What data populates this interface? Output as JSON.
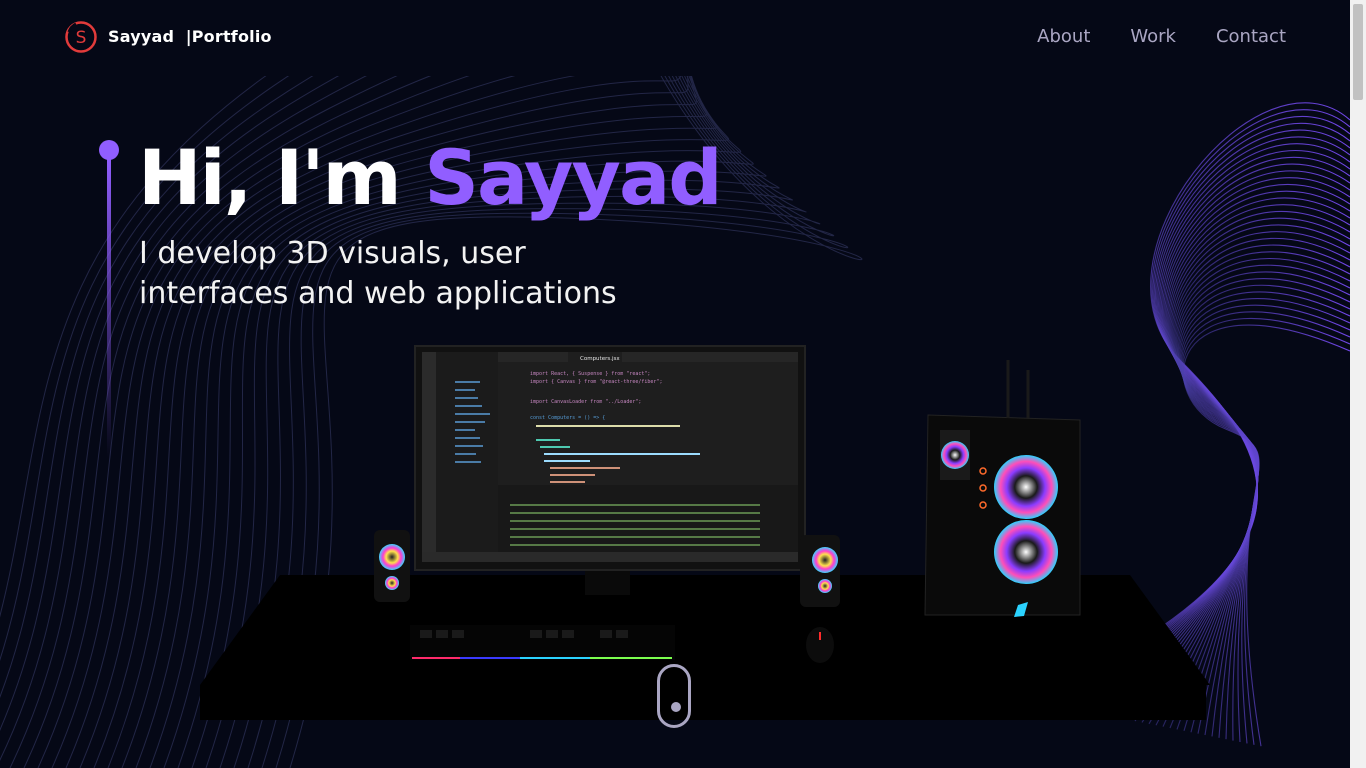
{
  "header": {
    "brand_name": "Sayyad",
    "brand_suffix": "|Portfolio",
    "logo_letter": "S",
    "nav": [
      {
        "label": "About"
      },
      {
        "label": "Work"
      },
      {
        "label": "Contact"
      }
    ]
  },
  "hero": {
    "greeting": "Hi, I'm",
    "name": "Sayyad",
    "subtitle_line1": "I develop 3D visuals, user",
    "subtitle_line2": "interfaces and web applications"
  },
  "scene": {
    "editor_tab": "Computers.jsx",
    "code_line1": "import React, { Suspense } from \"react\";",
    "code_line2": "import { Canvas } from \"@react-three/fiber\";",
    "code_line3": "import CanvasLoader from \"../Loader\";",
    "code_line4": "const Computers = () => {"
  },
  "colors": {
    "background": "#050816",
    "accent": "#915eff",
    "nav_text": "#aaa6c3",
    "logo_ring": "#e23b3b"
  },
  "icons": {
    "logo": "s-circle-logo-icon",
    "scroll": "mouse-scroll-icon"
  }
}
